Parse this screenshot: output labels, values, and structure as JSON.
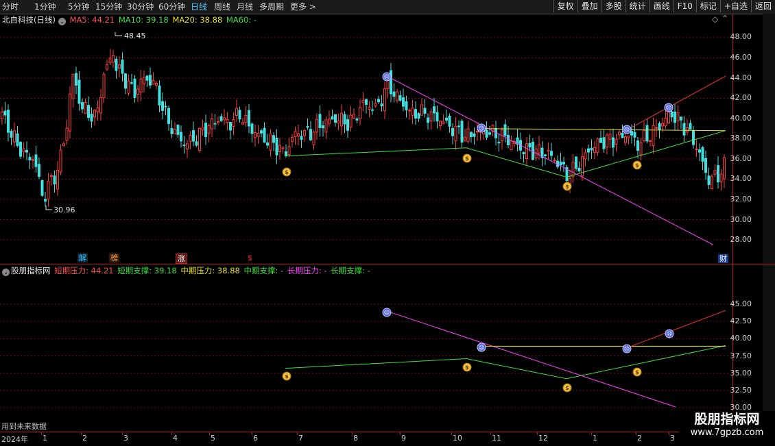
{
  "toolbar": {
    "periods": [
      "分时",
      "1分钟",
      "5分钟",
      "15分钟",
      "30分钟",
      "60分钟",
      "日线",
      "周线",
      "月线",
      "多周期",
      "更多"
    ],
    "active_period": "日线",
    "more_arrow": ">",
    "right_buttons": [
      "复权",
      "叠加",
      "多股",
      "统计",
      "画线",
      "F10",
      "标记",
      "+自选",
      "返回"
    ]
  },
  "main_legend": {
    "title": "北自科技(日线)",
    "items": [
      {
        "label": "MA5: 44.21",
        "color": "#ff5050"
      },
      {
        "label": "MA10: 39.18",
        "color": "#40e040"
      },
      {
        "label": "MA20: 38.88",
        "color": "#e6e020"
      },
      {
        "label": "MA60: -",
        "color": "#40e040"
      }
    ]
  },
  "main_axis": [
    "48.00",
    "46.00",
    "44.00",
    "42.00",
    "40.00",
    "38.00",
    "36.00",
    "34.00",
    "32.00",
    "30.00",
    "28.00"
  ],
  "main_price_labels": {
    "high": "48.45",
    "low": "30.96"
  },
  "event_tags": [
    {
      "text": "解",
      "color": "#40c0ff",
      "bg": "#103040"
    },
    {
      "text": "榜",
      "color": "#ff9040",
      "bg": "#302010"
    },
    {
      "text": "涨",
      "color": "#ffffff",
      "bg": "#602020"
    },
    {
      "text": "$",
      "color": "#ff3030",
      "bg": "#000"
    },
    {
      "text": "财",
      "color": "#ffffff",
      "bg": "#1a3a8a"
    }
  ],
  "sub_legend": {
    "title": "股朋指标网",
    "items": [
      {
        "label": "短期压力: 44.21",
        "color": "#ff5050"
      },
      {
        "label": "短期支撑: 39.18",
        "color": "#40e040"
      },
      {
        "label": "中期压力: 38.88",
        "color": "#e6e020"
      },
      {
        "label": "中期支撑: -",
        "color": "#40e040"
      },
      {
        "label": "长期压力: -",
        "color": "#ff40ff"
      },
      {
        "label": "长期支撑: -",
        "color": "#40e040"
      }
    ]
  },
  "sub_axis": [
    "45.00",
    "42.50",
    "40.00",
    "37.50",
    "35.00",
    "32.50",
    "30.00"
  ],
  "future_data_note": "用到未来数据",
  "x_axis": {
    "year": "2024年",
    "months": [
      "1",
      "2",
      "3",
      "4",
      "5",
      "6",
      "7",
      "8",
      "9",
      "10",
      "11",
      "12",
      "1",
      "2",
      "3"
    ]
  },
  "watermark": {
    "title": "股朋指标网",
    "url": "www.7gpzb.com"
  },
  "colors": {
    "up": "#ff3c3c",
    "down": "#40e0e0",
    "grid": "#8a1a1a",
    "separator": "#b02020"
  }
}
